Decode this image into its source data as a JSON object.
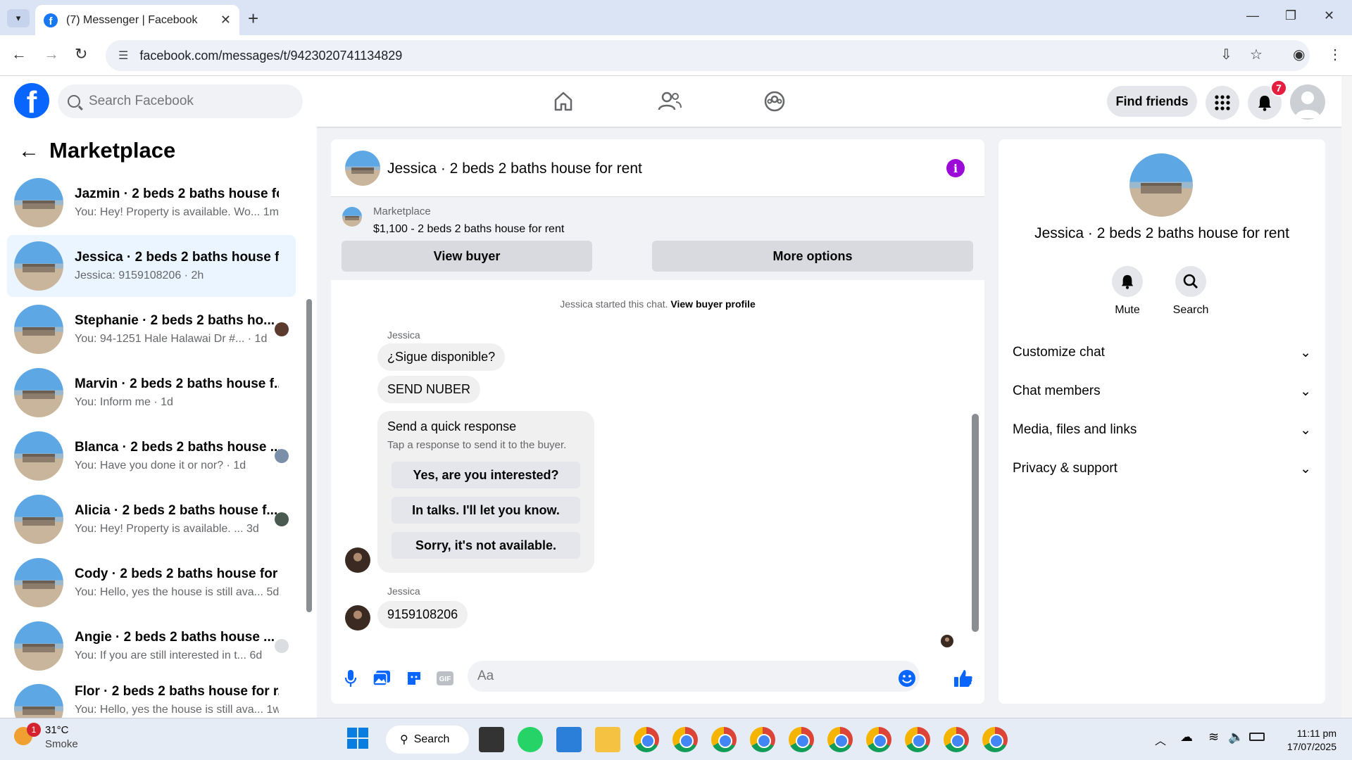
{
  "browser": {
    "tab_title": "(7) Messenger | Facebook",
    "url": "facebook.com/messages/t/9423020741134829"
  },
  "fb": {
    "search_placeholder": "Search Facebook",
    "find_friends": "Find friends",
    "notifications_count": "7"
  },
  "sidebar": {
    "title": "Marketplace",
    "conversations": [
      {
        "name": "Jazmin · 2 beds 2 baths house fo...",
        "preview": "You: Hey! Property is available. Wo...",
        "time": "1m"
      },
      {
        "name": "Jessica · 2 beds 2 baths house fo...",
        "preview": "Jessica: 9159108206",
        "time": "2h"
      },
      {
        "name": "Stephanie · 2 beds 2 baths ho...",
        "preview": "You: 94-1251 Hale Halawai Dr #...",
        "time": "1d"
      },
      {
        "name": "Marvin · 2 beds 2 baths house f...",
        "preview": "You: Inform me",
        "time": "1d"
      },
      {
        "name": "Blanca · 2 beds 2 baths house ...",
        "preview": "You: Have you done it or nor?",
        "time": "1d"
      },
      {
        "name": "Alicia · 2 beds 2 baths house f...",
        "preview": "You: Hey! Property is available. ...",
        "time": "3d"
      },
      {
        "name": "Cody · 2 beds 2 baths house for ...",
        "preview": "You: Hello, yes the house is still ava...",
        "time": "5d"
      },
      {
        "name": "Angie · 2 beds 2 baths house ...",
        "preview": "You: If you are still interested in t...",
        "time": "6d"
      },
      {
        "name": "Flor · 2 beds 2 baths house for r...",
        "preview": "You: Hello, yes the house is still ava...",
        "time": "1w"
      }
    ]
  },
  "chat": {
    "title": "Jessica · 2 beds 2 baths house for rent",
    "marketplace_label": "Marketplace",
    "listing": "$1,100 - 2 beds 2 baths house for rent",
    "view_buyer": "View buyer",
    "more_options": "More options",
    "start_note": "Jessica started this chat.",
    "view_buyer_profile": "View buyer profile",
    "sender": "Jessica",
    "messages": [
      "¿Sigue disponible?",
      "SEND NUBER",
      "9159108206"
    ],
    "quick_title": "Send a quick response",
    "quick_sub": "Tap a response to send it to the buyer.",
    "quick_options": [
      "Yes, are you interested?",
      "In talks. I'll let you know.",
      "Sorry, it's not available."
    ],
    "composer_placeholder": "Aa"
  },
  "details": {
    "name": "Jessica · 2 beds 2 baths house for rent",
    "mute": "Mute",
    "search": "Search",
    "sections": [
      "Customize chat",
      "Chat members",
      "Media, files and links",
      "Privacy & support"
    ]
  },
  "taskbar": {
    "temp": "31°C",
    "weather": "Smoke",
    "weather_badge": "1",
    "search": "Search",
    "time": "11:11 pm",
    "date": "17/07/2025"
  },
  "colors": {
    "fb_blue": "#0866ff",
    "selected": "#ebf5ff",
    "info": "#9b0ad6"
  }
}
